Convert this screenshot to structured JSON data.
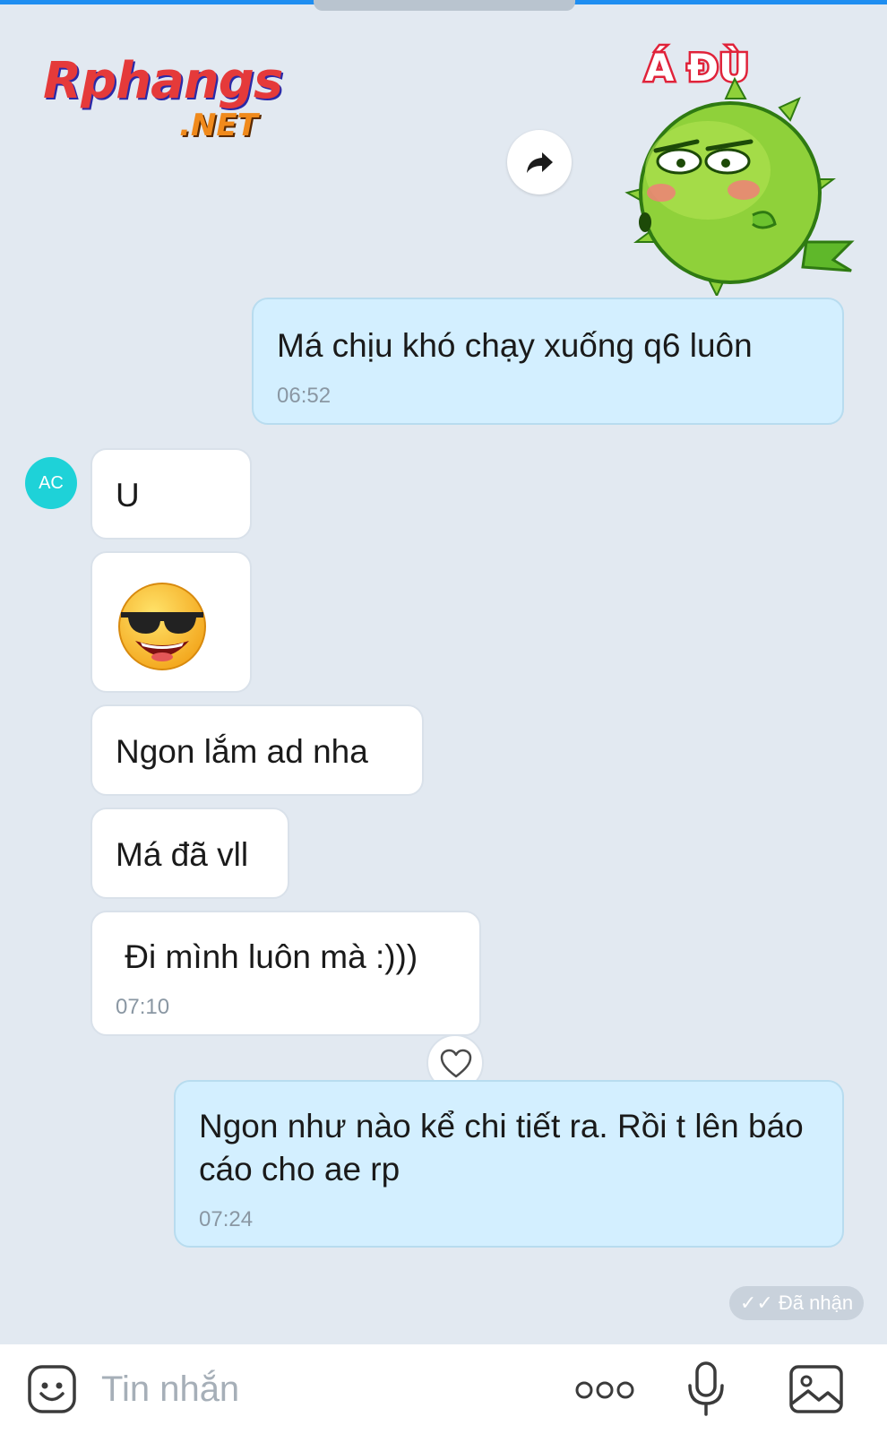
{
  "logo": {
    "main": "Rphangs",
    "sub": ".NET"
  },
  "sticker": {
    "caption": "Á ĐÙ"
  },
  "messages": {
    "m1": {
      "text": "Má chịu khó chạy xuống q6 luôn",
      "time": "06:52"
    },
    "avatar": "AC",
    "m2": {
      "text": "U"
    },
    "m3": {
      "emoji": "cool-sunglasses-emoji"
    },
    "m4": {
      "text": "Ngon lắm ad nha"
    },
    "m5": {
      "text": "Má đã vll"
    },
    "m6": {
      "text": " Đi mình luôn mà :)))",
      "time": "07:10"
    },
    "m7": {
      "text": "Ngon như nào kể chi tiết ra. Rồi t lên báo cáo cho ae rp",
      "time": "07:24"
    }
  },
  "receipt": {
    "label": "✓✓ Đã nhận"
  },
  "composer": {
    "placeholder": "Tin nhắn"
  },
  "icons": [
    "forward-icon",
    "heart-icon",
    "sticker-icon",
    "more-icon",
    "mic-icon",
    "image-icon"
  ],
  "colors": {
    "outgoing_bubble": "#d3efff",
    "incoming_bubble": "#ffffff",
    "background": "#e2e9f1",
    "avatar": "#1ed2d8",
    "accent": "#1f8ef1"
  }
}
